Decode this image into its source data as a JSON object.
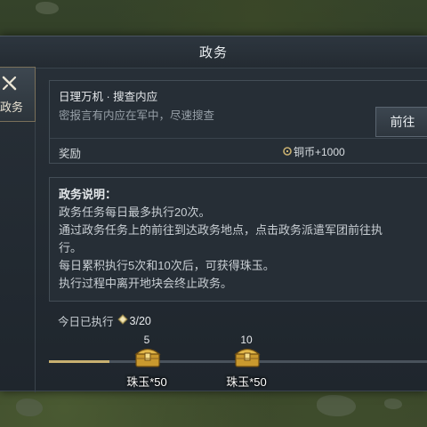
{
  "window": {
    "title": "政务"
  },
  "side_tab": {
    "label": "政务",
    "icon": "crossed-swords-icon"
  },
  "task": {
    "title": "日理万机 · 搜查内应",
    "description": "密报言有内应在军中，尽速搜查",
    "goto_label": "前往",
    "reward_label": "奖励",
    "reward_value": "铜币+1000",
    "reward_icon": "coin-icon"
  },
  "info": {
    "heading": "政务说明：",
    "lines": [
      "政务任务每日最多执行20次。",
      "通过政务任务上的前往到达政务地点，点击政务派遣军团前往执",
      "行。",
      "每日累积执行5次和10次后，可获得珠玉。",
      "执行过程中离开地块会终止政务。"
    ]
  },
  "daily": {
    "label": "今日已执行",
    "count": "3/20",
    "done": 3,
    "max": 20
  },
  "progress": {
    "fill_fraction": 0.16
  },
  "milestones": [
    {
      "threshold": "5",
      "reward": "珠玉*50",
      "icon": "treasure-chest-icon"
    },
    {
      "threshold": "10",
      "reward": "珠玉*50",
      "icon": "treasure-chest-icon"
    }
  ],
  "colors": {
    "panel_bg": "#1f262d",
    "accent_gold": "#c8b070",
    "text_primary": "#e6e9ec",
    "text_muted": "#97a0a8"
  }
}
